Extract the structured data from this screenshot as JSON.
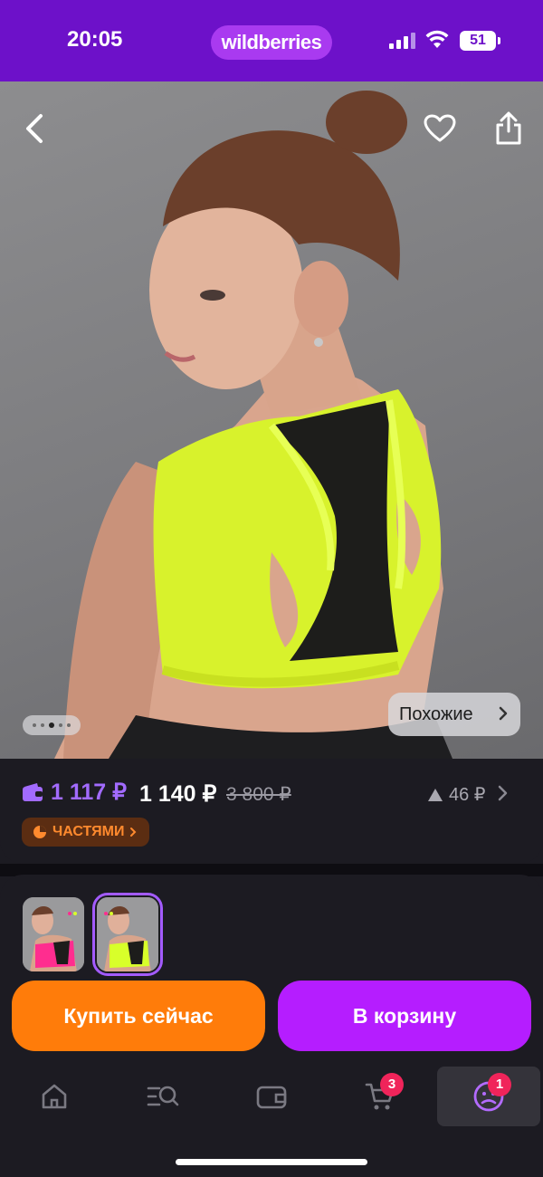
{
  "status_bar": {
    "time": "20:05",
    "brand": "wildberries",
    "battery": "51"
  },
  "product": {
    "similar_label": "Похожие",
    "gallery_dots": 5,
    "gallery_active_dot": 2
  },
  "price": {
    "wallet_price": "1 117 ₽",
    "current_price": "1 140 ₽",
    "old_price": "3 800 ₽",
    "delta": "46 ₽",
    "installments_label": "ЧАСТЯМИ"
  },
  "variants": [
    {
      "name": "pink",
      "selected": false,
      "color": "#ff2d8f"
    },
    {
      "name": "lime",
      "selected": true,
      "color": "#d8ff2a"
    }
  ],
  "actions": {
    "buy_now": "Купить сейчас",
    "add_to_cart": "В корзину"
  },
  "tabbar": {
    "items": [
      {
        "icon": "home-icon"
      },
      {
        "icon": "catalog-search-icon"
      },
      {
        "icon": "wallet-icon"
      },
      {
        "icon": "cart-icon",
        "badge": "3"
      },
      {
        "icon": "profile-icon",
        "badge": "1",
        "active": true
      }
    ]
  },
  "colors": {
    "brand_purple": "#6d11c9",
    "buy_orange": "#ff7c0a",
    "cart_purple": "#b51dff",
    "badge_red": "#f0245a"
  }
}
